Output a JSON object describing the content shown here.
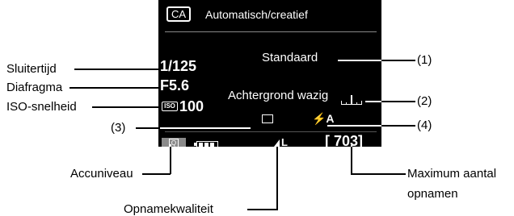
{
  "screen": {
    "mode_badge": "CA",
    "mode_title": "Automatisch/creatief",
    "shutter": "1/125",
    "aperture": "F5.6",
    "iso_prefix": "ISO",
    "iso": "100",
    "ambience": "Standaard",
    "background_blur": "Achtergrond wazig",
    "quick_button": "Q",
    "flash_mode": "⚡A",
    "quality": "L",
    "shots": "[ 703]"
  },
  "callouts": {
    "shutter": "Sluitertijd",
    "aperture": "Diafragma",
    "iso": "ISO-snelheid",
    "battery": "Accuniveau",
    "quality": "Opnamekwaliteit",
    "shots_line1": "Maximum aantal",
    "shots_line2": "opnamen",
    "n1": "(1)",
    "n2": "(2)",
    "n3": "(3)",
    "n4": "(4)"
  },
  "colors": {
    "screen_bg": "#000000",
    "screen_text": "#ffffff",
    "quick_button_bg": "#8a8a8a",
    "separator": "#888888"
  },
  "icons": [
    "camera-mode-badge",
    "iso-icon",
    "blur-slider-icon",
    "drive-mode-icon",
    "flash-auto-icon",
    "battery-icon",
    "image-quality-icon"
  ]
}
